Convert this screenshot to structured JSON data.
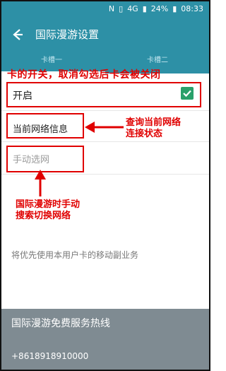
{
  "statusbar": {
    "left_symbol": "N",
    "network_label": "4G",
    "battery": "24%",
    "time": "08:33"
  },
  "appbar": {
    "title": "国际漫游设置"
  },
  "tabs": [
    {
      "label": "卡槽一"
    },
    {
      "label": "卡槽二"
    }
  ],
  "annotations": {
    "top": "卡的开关，取消勾选后卡会被关闭",
    "network_info": [
      "查询当前网络",
      "连接状态"
    ],
    "manual_search": [
      "国际漫游时手动",
      "搜索切换网络"
    ]
  },
  "rows": {
    "enable": "开启",
    "network_info": "当前网络信息",
    "manual_select": "手动选网"
  },
  "note": "将优先使用本用户卡的移动副业务",
  "footer": {
    "title": "国际漫游免费服务热线",
    "number": "+8618918910000"
  },
  "colors": {
    "appbar": "#2d90a6",
    "annotation_red": "#e00000",
    "check_green": "#2aa06a",
    "footer": "#7f8b92"
  }
}
